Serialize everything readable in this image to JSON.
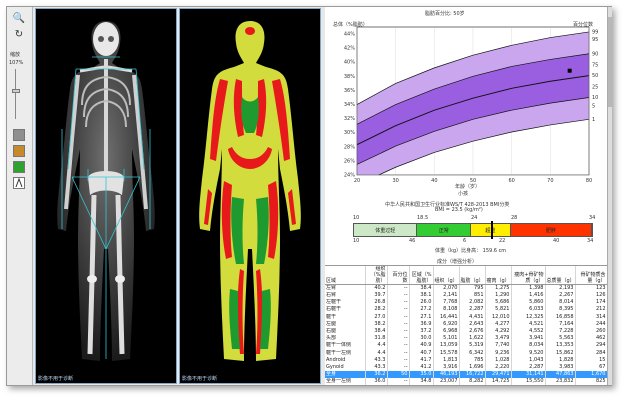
{
  "toolbar": {
    "zoom_label": "缩放",
    "zoom_value": "107%"
  },
  "panels": {
    "skeleton_caption": "影像不用于诊断",
    "composition_caption": "影像不用于诊断"
  },
  "chart_data": {
    "type": "area",
    "title": "脂肪百分比: 50岁",
    "ylabel": "总体（%脂肪）",
    "y2label": "百分位数",
    "xlabel": "年龄（岁）",
    "xlabel_sub": "小孩",
    "x_ticks": [
      "20",
      "30",
      "40",
      "50",
      "60",
      "70",
      "80"
    ],
    "y_ticks": [
      "44%",
      "42%",
      "40%",
      "38%",
      "36%",
      "34%",
      "32%",
      "30%",
      "28%",
      "26%",
      "24%"
    ],
    "y2_ticks": [
      "99",
      "95",
      "90",
      "75",
      "50",
      "25",
      "10",
      "5",
      "1"
    ],
    "xlim": [
      20,
      80
    ],
    "ylim": [
      24,
      45
    ],
    "series": [
      {
        "x": [
          20,
          30,
          40,
          50,
          60,
          70,
          80
        ],
        "values": [
          34.0,
          37.0,
          39.2,
          41.0,
          42.4,
          43.5,
          44.3
        ]
      },
      {
        "x": [
          20,
          30,
          40,
          50,
          60,
          70,
          80
        ],
        "values": [
          31.2,
          34.0,
          36.2,
          38.0,
          39.4,
          40.4,
          41.2
        ]
      },
      {
        "x": [
          20,
          30,
          40,
          50,
          60,
          70,
          80
        ],
        "values": [
          28.3,
          31.0,
          33.2,
          34.9,
          36.3,
          37.3,
          38.1
        ]
      },
      {
        "x": [
          20,
          30,
          40,
          50,
          60,
          70,
          80
        ],
        "values": [
          25.5,
          28.1,
          30.2,
          31.9,
          33.2,
          34.2,
          35.0
        ]
      },
      {
        "x": [
          20,
          30,
          40,
          50,
          60,
          70,
          80
        ],
        "values": [
          22.6,
          25.1,
          27.2,
          28.8,
          30.1,
          31.1,
          31.9
        ]
      }
    ],
    "patient_point": {
      "x": 75,
      "y": 38.8
    }
  },
  "bmi": {
    "title": "中华人民共和国卫生行业标准WS/T 428-2013 BMI分类",
    "subtitle": "BMI = 23.5 (kg/m²)",
    "ticks": [
      "10",
      "18.5",
      "24",
      "28",
      "34"
    ],
    "segments": [
      {
        "label": "体重过轻",
        "color": "#cde8c6"
      },
      {
        "label": "正常",
        "color": "#33cc33"
      },
      {
        "label": "超重",
        "color": "#ffee00"
      },
      {
        "label": "肥胖",
        "color": "#ff3300"
      }
    ],
    "bottom_ticks": [
      "10",
      "46",
      "6",
      "22",
      "40",
      "34"
    ],
    "value": 23.5,
    "caption": "体重（kg）比身高： 159.6 cm"
  },
  "table": {
    "title": "成分（增强分析）",
    "headers": [
      "区域",
      "组织（%脂肪）",
      "百分位数",
      "区域（%脂肪）",
      "组织（g）",
      "脂肪（g）",
      "瘦肉（g）",
      "瘦肉+骨矿物质（g）",
      "总质量（g）",
      "骨矿物质含量（g）"
    ],
    "rows": [
      [
        "左臂",
        "40.2",
        "--",
        "38.4",
        "2,070",
        "795",
        "1,275",
        "1,398",
        "2,193",
        "123"
      ],
      [
        "右臂",
        "39.7",
        "--",
        "38.1",
        "2,141",
        "851",
        "1,290",
        "1,416",
        "2,267",
        "126"
      ],
      [
        "左躯干",
        "26.8",
        "--",
        "26.0",
        "7,768",
        "2,082",
        "5,686",
        "5,860",
        "8,014",
        "174"
      ],
      [
        "右躯干",
        "28.2",
        "--",
        "27.2",
        "8,108",
        "2,287",
        "5,821",
        "6,033",
        "8,395",
        "212"
      ],
      [
        "躯干",
        "27.0",
        "--",
        "27.1",
        "16,441",
        "4,431",
        "12,010",
        "12,325",
        "16,858",
        "314"
      ],
      [
        "左腿",
        "38.2",
        "--",
        "36.9",
        "6,920",
        "2,643",
        "4,277",
        "4,521",
        "7,164",
        "244"
      ],
      [
        "右腿",
        "38.4",
        "--",
        "37.2",
        "6,968",
        "2,676",
        "4,292",
        "4,552",
        "7,228",
        "260"
      ],
      [
        "头部",
        "31.8",
        "--",
        "30.0",
        "5,101",
        "1,622",
        "3,479",
        "3,941",
        "5,563",
        "462"
      ],
      [
        "躯干一体侧",
        "4.4",
        "--",
        "40.9",
        "13,059",
        "5,319",
        "7,740",
        "8,034",
        "13,353",
        "294"
      ],
      [
        "躯干一左侧",
        "4.4",
        "--",
        "40.7",
        "15,578",
        "6,342",
        "9,236",
        "9,520",
        "15,862",
        "284"
      ],
      [
        "Android",
        "43.3",
        "--",
        "41.7",
        "1,813",
        "785",
        "1,028",
        "1,043",
        "1,828",
        "15"
      ],
      [
        "Gynoid",
        "43.3",
        "--",
        "41.2",
        "3,916",
        "1,696",
        "2,220",
        "2,287",
        "3,983",
        "67"
      ],
      [
        "全身",
        "36.2",
        "50",
        "35.0",
        "46,193",
        "16,722",
        "29,471",
        "31,141",
        "47,863",
        "1,670"
      ],
      [
        "全身一左侧",
        "36.0",
        "--",
        "34.8",
        "23,007",
        "8,282",
        "14,725",
        "15,550",
        "23,832",
        "825"
      ],
      [
        "全身一右侧",
        "36.5",
        "--",
        "35.3",
        "23,186",
        "8,440",
        "14,746",
        "15,591",
        "24,031",
        "845"
      ]
    ],
    "selected_row": 12
  }
}
